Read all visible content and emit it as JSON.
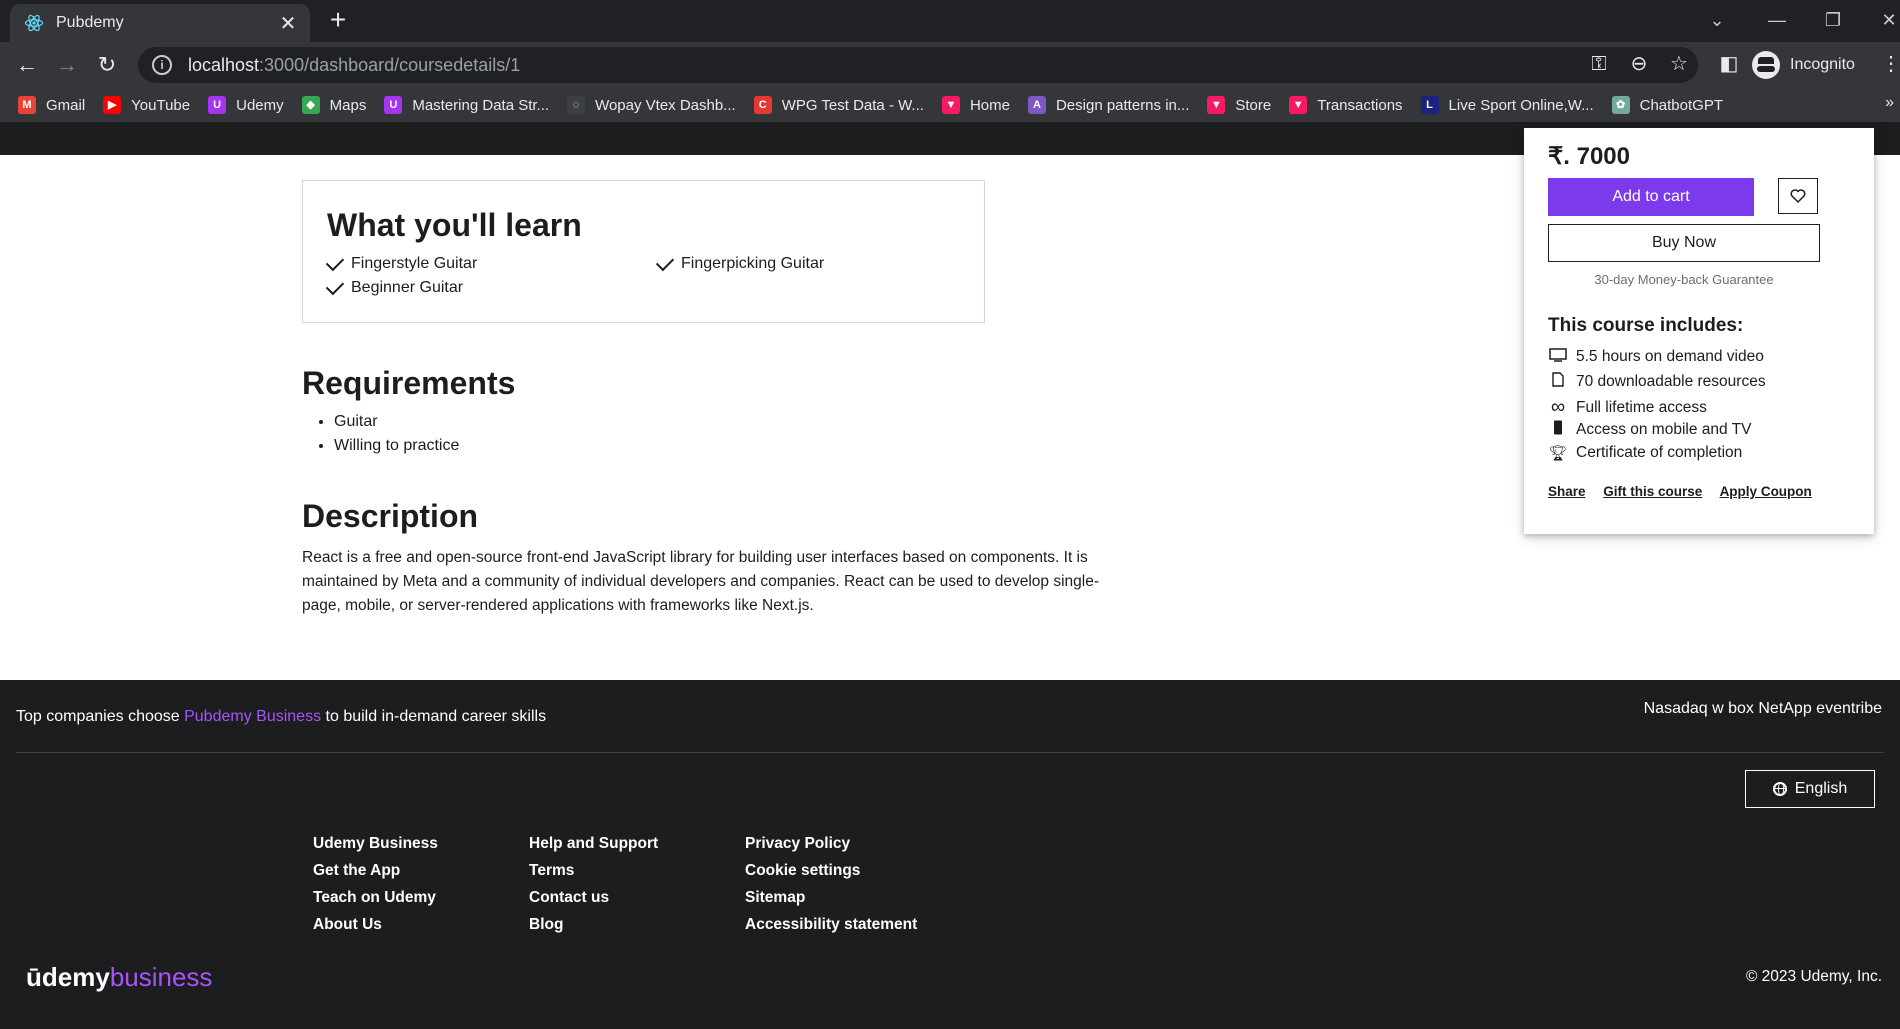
{
  "browser": {
    "tab_title": "Pubdemy",
    "url_host": "localhost",
    "url_path": ":3000/dashboard/coursedetails/1",
    "profile_label": "Incognito",
    "bookmarks": [
      {
        "label": "Gmail",
        "icon": "gmail-icon",
        "color": "#ea4335"
      },
      {
        "label": "YouTube",
        "icon": "youtube-icon",
        "color": "#ff0000"
      },
      {
        "label": "Udemy",
        "icon": "udemy-icon",
        "color": "#a435f0"
      },
      {
        "label": "Maps",
        "icon": "maps-icon",
        "color": "#34a853"
      },
      {
        "label": "Mastering Data Str...",
        "icon": "udemy-icon",
        "color": "#a435f0"
      },
      {
        "label": "Wopay Vtex Dashb...",
        "icon": "globe-icon",
        "color": "#3c4043"
      },
      {
        "label": "WPG Test Data - W...",
        "icon": "c-icon",
        "color": "#e53935"
      },
      {
        "label": "Home",
        "icon": "vtex-icon",
        "color": "#f71963"
      },
      {
        "label": "Design patterns in...",
        "icon": "angular-icon",
        "color": "#7e57c2"
      },
      {
        "label": "Store",
        "icon": "vtex-icon",
        "color": "#f71963"
      },
      {
        "label": "Transactions",
        "icon": "vtex-icon",
        "color": "#f71963"
      },
      {
        "label": "Live Sport Online,W...",
        "icon": "live-icon",
        "color": "#1a237e"
      },
      {
        "label": "ChatbotGPT",
        "icon": "chatgpt-icon",
        "color": "#74aa9c"
      }
    ],
    "bookmarks_more": "»"
  },
  "learn": {
    "title": "What you'll learn",
    "items": [
      "Fingerstyle Guitar",
      "Fingerpicking Guitar",
      "Beginner Guitar"
    ]
  },
  "requirements": {
    "title": "Requirements",
    "items": [
      "Guitar",
      "Willing to practice"
    ]
  },
  "description": {
    "title": "Description",
    "text": "React is a free and open-source front-end JavaScript library for building user interfaces based on components. It is maintained by Meta and a community of individual developers and companies. React can be used to develop single-page, mobile, or server-rendered applications with frameworks like Next.js."
  },
  "card": {
    "price": "₹. 7000",
    "add_to_cart": "Add to cart",
    "buy_now": "Buy Now",
    "guarantee": "30-day Money-back Guarantee",
    "includes_title": "This course includes:",
    "includes": [
      {
        "icon": "monitor-icon",
        "label": "5.5 hours on demand video"
      },
      {
        "icon": "file-icon",
        "label": "70 downloadable resources"
      },
      {
        "icon": "infinity-icon",
        "label": "Full lifetime access"
      },
      {
        "icon": "mobile-icon",
        "label": "Access on mobile and TV"
      },
      {
        "icon": "trophy-icon",
        "label": "Certificate of completion"
      }
    ],
    "links": [
      "Share",
      "Gift this course",
      "Apply Coupon"
    ]
  },
  "footer": {
    "top_prefix": "Top companies choose ",
    "top_brand": "Pubdemy Business",
    "top_suffix": " to build in-demand career skills",
    "companies": "Nasadaq w box NetApp eventribe",
    "language": "English",
    "col1": [
      "Udemy Business",
      "Get the App",
      "Teach on Udemy",
      "About Us"
    ],
    "col2": [
      "Help and Support",
      "Terms",
      "Contact us",
      "Blog"
    ],
    "col3": [
      "Privacy Policy",
      "Cookie settings",
      "Sitemap",
      "Accessibility statement"
    ],
    "logo_main": "ūdemy",
    "logo_sub": "business",
    "copyright": "© 2023 Udemy, Inc."
  }
}
